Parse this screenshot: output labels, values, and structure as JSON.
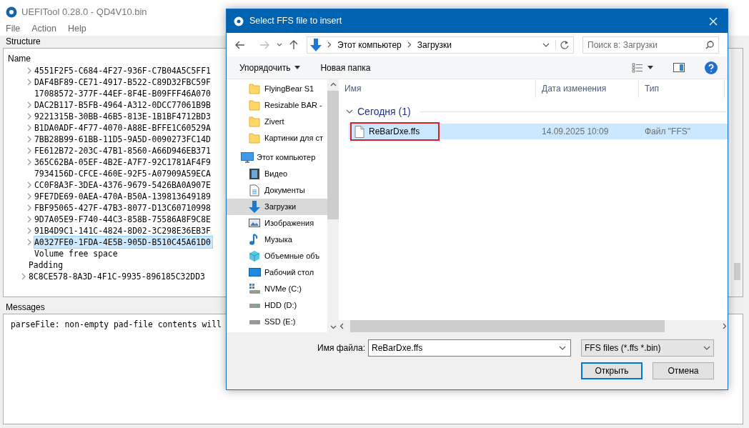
{
  "app": {
    "title": "UEFITool 0.28.0 - QD4V10.bin",
    "menu": [
      "File",
      "Action",
      "Help"
    ]
  },
  "structure": {
    "title": "Structure",
    "column": "Name",
    "tree": [
      {
        "children": [
          {
            "label": "4551F2F5-C684-4F27-936F-C7B04A5C5FF1",
            "expandable": true,
            "selected": false
          },
          {
            "label": "DAF4BF89-CE71-4917-B522-C89D32FBC59F",
            "expandable": true,
            "selected": false
          },
          {
            "label": "17088572-377F-44EF-8F4E-B09FFF46A070",
            "expandable": false,
            "selected": false
          },
          {
            "label": "DAC2B117-B5FB-4964-A312-0DCC77061B9B",
            "expandable": true,
            "selected": false
          },
          {
            "label": "9221315B-30BB-46B5-813E-1B1BF4712BD3",
            "expandable": true,
            "selected": false
          },
          {
            "label": "B1DA0ADF-4F77-4070-A88E-BFFE1C60529A",
            "expandable": true,
            "selected": false
          },
          {
            "label": "7BB28B99-61BB-11D5-9A5D-0090273FC14D",
            "expandable": true,
            "selected": false
          },
          {
            "label": "FE612B72-203C-47B1-8560-A66D946EB371",
            "expandable": true,
            "selected": false
          },
          {
            "label": "365C62BA-05EF-4B2E-A7F7-92C1781AF4F9",
            "expandable": true,
            "selected": false
          },
          {
            "label": "7934156D-CFCE-460E-92F5-A07909A59ECA",
            "expandable": false,
            "selected": false
          },
          {
            "label": "CC0F8A3F-3DEA-4376-9679-5426BA0A907E",
            "expandable": true,
            "selected": false
          },
          {
            "label": "9FE7DE69-0AEA-470A-B50A-139813649189",
            "expandable": true,
            "selected": false
          },
          {
            "label": "FBF95065-427F-47B3-8077-D13C60710998",
            "expandable": true,
            "selected": false
          },
          {
            "label": "9D7A05E9-F740-44C3-858B-75586A8F9C8E",
            "expandable": true,
            "selected": false
          },
          {
            "label": "91B4D9C1-141C-4824-8D02-3C298E36EB3F",
            "expandable": true,
            "selected": false
          },
          {
            "label": "A0327FE0-1FDA-4E5B-905D-B510C45A61D0",
            "expandable": true,
            "selected": true
          },
          {
            "label": "Volume free space",
            "expandable": false,
            "selected": false
          }
        ]
      },
      {
        "label": "Padding",
        "expandable": false,
        "selected": false
      },
      {
        "label": "8C8CE578-8A3D-4F1C-9935-896185C32DD3",
        "expandable": true,
        "selected": false
      }
    ]
  },
  "messages": {
    "title": "Messages",
    "lines": [
      "parseFile: non-empty pad-file contents will"
    ]
  },
  "dialog": {
    "title": "Select FFS file to insert",
    "breadcrumb": [
      "Этот компьютер",
      "Загрузки"
    ],
    "search": {
      "placeholder": "Поиск в: Загрузки"
    },
    "toolbar": [
      {
        "label": "Упорядочить",
        "dropdown": true
      },
      {
        "label": "Новая папка",
        "dropdown": false
      }
    ],
    "sidebar": [
      {
        "children": [
          {
            "label": "FlyingBear S1",
            "kind": "folder",
            "selected": false
          },
          {
            "label": "Resizable BAR -",
            "kind": "folder",
            "selected": false
          },
          {
            "label": "Zivert",
            "kind": "folder",
            "selected": false
          },
          {
            "label": "Картинки для ст",
            "kind": "folder",
            "selected": false
          }
        ]
      },
      {
        "label": "Этот компьютер",
        "kind": "computer",
        "selected": false,
        "children": [
          {
            "label": "Видео",
            "kind": "video",
            "selected": false
          },
          {
            "label": "Документы",
            "kind": "document",
            "selected": false
          },
          {
            "label": "Загрузки",
            "kind": "download",
            "selected": true
          },
          {
            "label": "Изображения",
            "kind": "image",
            "selected": false
          },
          {
            "label": "Музыка",
            "kind": "music",
            "selected": false
          },
          {
            "label": "Объемные объ",
            "kind": "cube",
            "selected": false
          },
          {
            "label": "Рабочий стол",
            "kind": "desktop",
            "selected": false
          },
          {
            "label": "NVMe (C:)",
            "kind": "system-drive",
            "selected": false
          },
          {
            "label": "HDD (D:)",
            "kind": "drive",
            "selected": false
          },
          {
            "label": "SSD (E:)",
            "kind": "drive",
            "selected": false
          }
        ]
      }
    ],
    "columns": [
      "Имя",
      "Дата изменения",
      "Тип"
    ],
    "groups": [
      {
        "label": "Сегодня (1)",
        "expanded": true,
        "files": [
          {
            "name": "ReBarDxe.ffs",
            "date": "14.09.2025 10:09",
            "type": "Файл \"FFS\"",
            "selected": true,
            "highlighted": true
          }
        ]
      }
    ],
    "filename_label": "Имя файла:",
    "filename": "ReBarDxe.ffs",
    "filter": "FFS files (*.ffs *.bin)",
    "buttons": [
      {
        "label": "Открыть",
        "default": true
      },
      {
        "label": "Отмена",
        "default": false
      }
    ]
  }
}
